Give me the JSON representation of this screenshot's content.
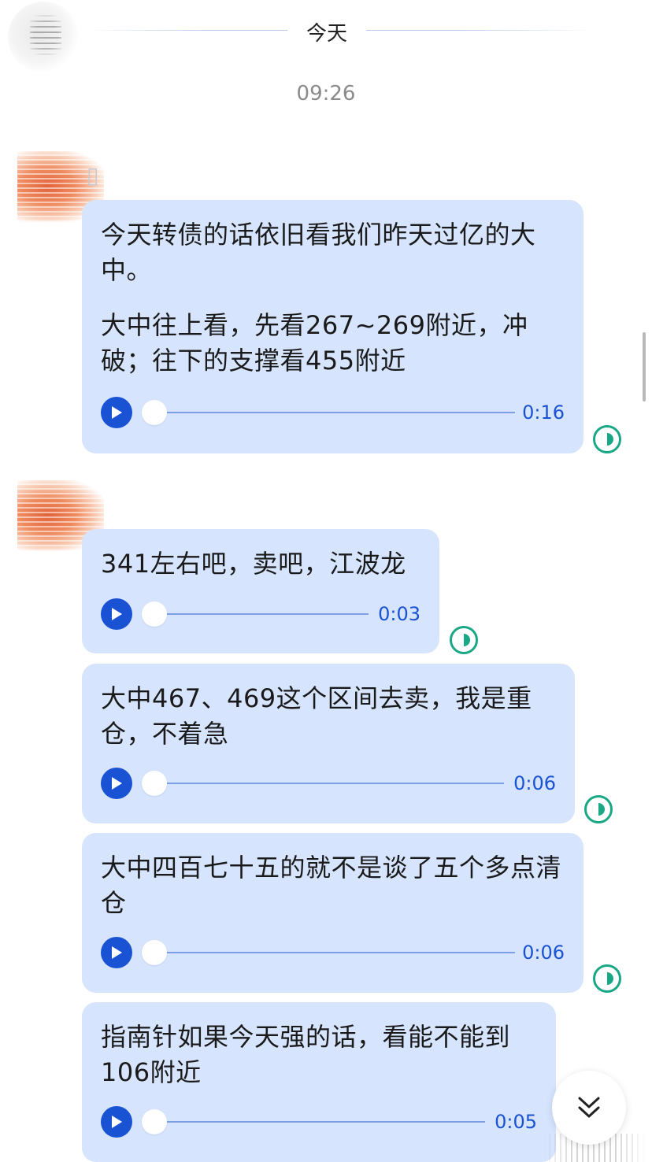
{
  "date_separator": "今天",
  "timestamp": "09:26",
  "messages": [
    {
      "paragraphs": [
        "今天转债的话依旧看我们昨天过亿的大中。",
        "大中往上看，先看267~269附近，冲破；往下的支撑看455附近"
      ],
      "duration": "0:16",
      "progress": 0
    },
    {
      "paragraphs": [
        "341左右吧，卖吧，江波龙"
      ],
      "duration": "0:03",
      "progress": 0
    },
    {
      "paragraphs": [
        "大中467、469这个区间去卖，我是重仓，不着急"
      ],
      "duration": "0:06",
      "progress": 0
    },
    {
      "paragraphs": [
        "大中四百七十五的就不是谈了五个多点清仓"
      ],
      "duration": "0:06",
      "progress": 0
    },
    {
      "paragraphs": [
        "指南针如果今天强的话，看能不能到106附近"
      ],
      "duration": "0:05",
      "progress": 0
    }
  ],
  "icons": {
    "play": "play-icon",
    "status": "half-circle-status-icon",
    "scroll_down": "double-chevron-down-icon"
  },
  "colors": {
    "bubble": "#d6e4fd",
    "accent": "#1953d4",
    "status": "#18a886"
  }
}
